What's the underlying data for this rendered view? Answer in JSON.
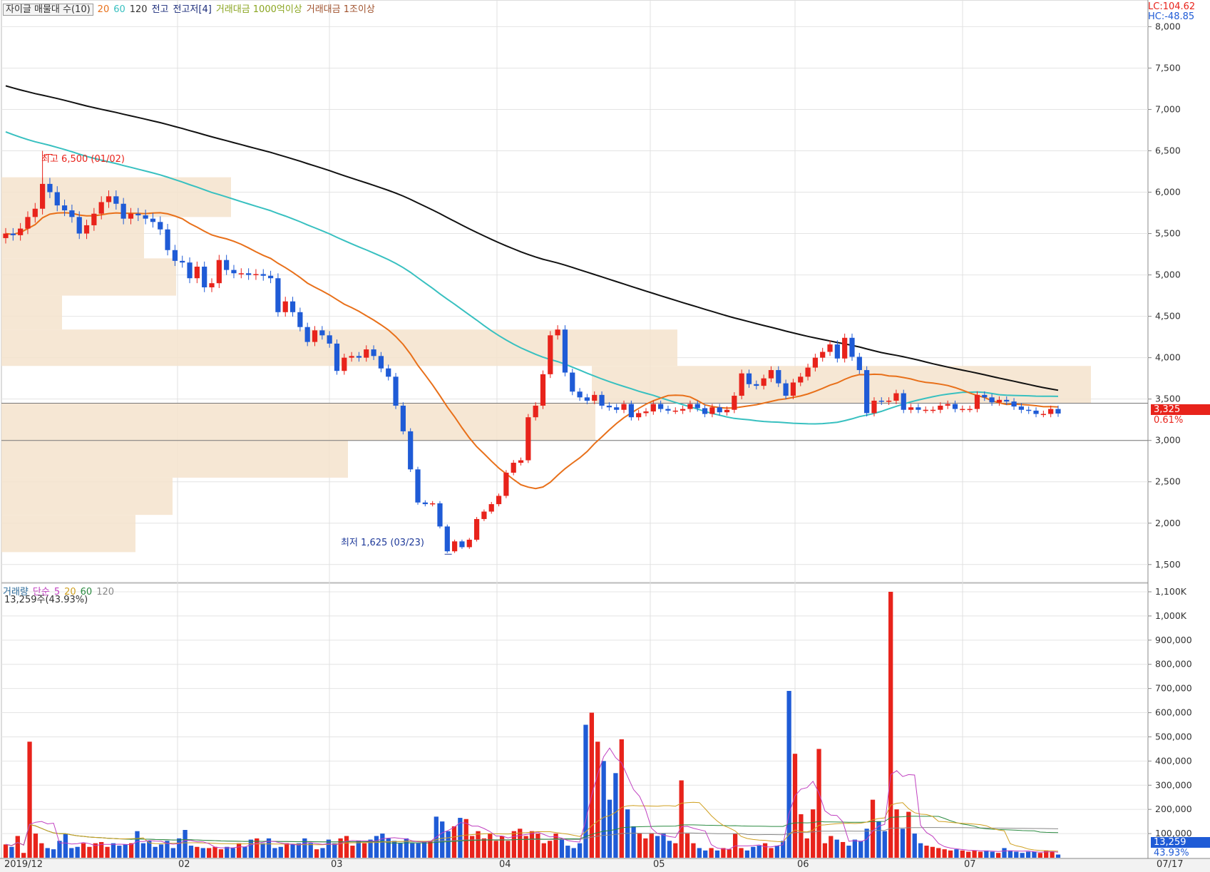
{
  "legend": {
    "title": "자이글 매물대 수(10)",
    "ma20": "20",
    "ma60": "60",
    "ma120": "120",
    "high_label": "전고",
    "high_item": "전고저[4]",
    "amount1": "거래대금 1000억이상",
    "amount2": "거래대금 1조이상",
    "colors": {
      "ma20": "#e8701a",
      "ma60": "#38c0c0",
      "ma120": "#111111",
      "up": "#e8231b",
      "down": "#1f5bd6",
      "profile": "#f5e3cc"
    }
  },
  "top_right": {
    "lc": "LC:104.62",
    "hc": "HC:-48.85"
  },
  "annotations": {
    "max": "최고 6,500 (01/02)",
    "min": "최저 1,625 (03/23)"
  },
  "last_price": {
    "value": "3,325",
    "pct": "0.61%"
  },
  "volume_legend": {
    "title": "거래량",
    "ma_label": "단순",
    "p1": "5",
    "p2": "20",
    "p3": "60",
    "p4": "120",
    "current": "13,259주(43.93%)"
  },
  "volume_last": {
    "value": "13,259",
    "pct": "43.93%"
  },
  "x_labels": [
    "2019/12",
    "02",
    "03",
    "04",
    "05",
    "06",
    "07",
    "07/17"
  ],
  "chart_data": [
    {
      "type": "candlestick",
      "price_axis": {
        "ticks": [
          "8,000",
          "7,500",
          "7,000",
          "6,500",
          "6,000",
          "5,500",
          "5,000",
          "4,500",
          "4,000",
          "3,500",
          "3,000",
          "2,500",
          "2,000",
          "1,500"
        ],
        "ylim": [
          1300,
          8150
        ]
      },
      "ohlc_close": [
        5500,
        5480,
        5560,
        5700,
        5800,
        6100,
        6000,
        5840,
        5780,
        5700,
        5500,
        5600,
        5740,
        5880,
        5950,
        5860,
        5680,
        5740,
        5720,
        5680,
        5640,
        5550,
        5300,
        5170,
        5150,
        4960,
        5100,
        4850,
        4900,
        5180,
        5060,
        5020,
        5020,
        5000,
        5010,
        4990,
        4960,
        4550,
        4680,
        4550,
        4370,
        4190,
        4330,
        4270,
        4170,
        3840,
        4000,
        4020,
        4000,
        4100,
        4020,
        3870,
        3770,
        3420,
        3110,
        2650,
        2250,
        2230,
        2240,
        1960,
        1660,
        1780,
        1710,
        1800,
        2050,
        2140,
        2230,
        2330,
        2610,
        2730,
        2760,
        3280,
        3420,
        3800,
        4270,
        4340,
        3820,
        3590,
        3520,
        3480,
        3550,
        3420,
        3400,
        3370,
        3440,
        3280,
        3330,
        3350,
        3440,
        3380,
        3360,
        3360,
        3380,
        3440,
        3390,
        3320,
        3400,
        3340,
        3370,
        3540,
        3810,
        3680,
        3660,
        3750,
        3850,
        3690,
        3540,
        3700,
        3770,
        3880,
        4000,
        4070,
        4160,
        3990,
        4240,
        4010,
        3850,
        3330,
        3480,
        3470,
        3480,
        3570,
        3370,
        3400,
        3370,
        3370,
        3370,
        3420,
        3440,
        3380,
        3380,
        3380,
        3550,
        3520,
        3460,
        3490,
        3470,
        3410,
        3370,
        3360,
        3320,
        3320,
        3380,
        3325
      ],
      "ma20_end": 3380,
      "ma60_end": 3520,
      "ma120_end": 3620,
      "max": 6500,
      "min": 1625
    },
    {
      "type": "bar",
      "name": "거래량",
      "volume_axis": {
        "ticks": [
          "1,100K",
          "1,000K",
          "900,000",
          "800,000",
          "700,000",
          "600,000",
          "500,000",
          "400,000",
          "300,000",
          "200,000",
          "100,000"
        ],
        "ylim": [
          0,
          1100000
        ]
      },
      "values": [
        55000,
        45000,
        90000,
        20000,
        480000,
        100000,
        60000,
        40000,
        35000,
        70000,
        100000,
        40000,
        45000,
        60000,
        45000,
        60000,
        65000,
        45000,
        60000,
        50000,
        55000,
        60000,
        110000,
        60000,
        70000,
        45000,
        55000,
        70000,
        40000,
        80000,
        115000,
        50000,
        45000,
        40000,
        40000,
        45000,
        35000,
        45000,
        40000,
        60000,
        45000,
        75000,
        80000,
        60000,
        80000,
        40000,
        45000,
        60000,
        55000,
        60000,
        80000,
        60000,
        35000,
        40000,
        75000,
        60000,
        80000,
        90000,
        50000,
        70000,
        60000,
        75000,
        90000,
        100000,
        80000,
        70000,
        60000,
        80000,
        60000,
        60000,
        65000,
        70000,
        170000,
        150000,
        110000,
        130000,
        165000,
        160000,
        90000,
        110000,
        80000,
        100000,
        70000,
        90000,
        70000,
        110000,
        120000,
        90000,
        110000,
        100000,
        60000,
        70000,
        100000,
        75000,
        50000,
        40000,
        60000,
        550000,
        600000,
        480000,
        400000,
        240000,
        350000,
        490000,
        200000,
        130000,
        100000,
        80000,
        100000,
        90000,
        100000,
        70000,
        60000,
        320000,
        100000,
        60000,
        40000,
        30000,
        40000,
        30000,
        40000,
        35000,
        100000,
        40000,
        30000,
        45000,
        50000,
        60000,
        40000,
        50000,
        70000,
        690000,
        430000,
        180000,
        80000,
        200000,
        450000,
        60000,
        90000,
        75000,
        65000,
        50000,
        75000,
        70000,
        120000,
        240000,
        150000,
        110000,
        1100000,
        200000,
        120000,
        190000,
        100000,
        60000,
        50000,
        45000,
        40000,
        35000,
        30000,
        35000,
        30000,
        25000,
        30000,
        25000,
        30000,
        25000,
        20000,
        40000,
        30000,
        25000,
        20000,
        25000,
        25000,
        20000,
        30000,
        25000,
        13259
      ]
    }
  ]
}
